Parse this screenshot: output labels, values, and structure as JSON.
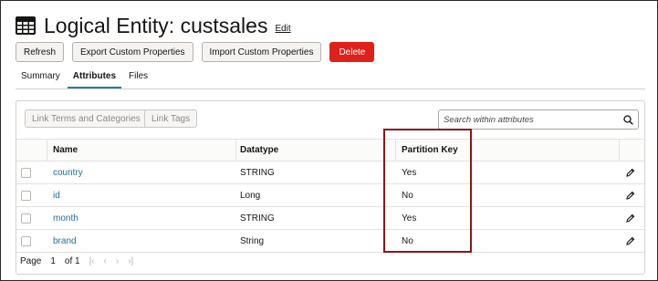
{
  "header": {
    "title": "Logical Entity: custsales",
    "edit_label": "Edit"
  },
  "toolbar": {
    "refresh": "Refresh",
    "export": "Export Custom Properties",
    "import": "Import Custom Properties",
    "delete": "Delete"
  },
  "tabs": [
    {
      "label": "Summary",
      "active": false
    },
    {
      "label": "Attributes",
      "active": true
    },
    {
      "label": "Files",
      "active": false
    }
  ],
  "actions": {
    "link_terms": "Link Terms and Categories",
    "link_tags": "Link Tags"
  },
  "search": {
    "placeholder": "Search within attributes"
  },
  "table": {
    "columns": [
      "Name",
      "Datatype",
      "Partition Key"
    ],
    "rows": [
      {
        "name": "country",
        "datatype": "STRING",
        "partition_key": "Yes"
      },
      {
        "name": "id",
        "datatype": "Long",
        "partition_key": "No"
      },
      {
        "name": "month",
        "datatype": "STRING",
        "partition_key": "Yes"
      },
      {
        "name": "brand",
        "datatype": "String",
        "partition_key": "No"
      }
    ]
  },
  "pager": {
    "page_label": "Page",
    "current": "1",
    "of_label": "of 1"
  },
  "colors": {
    "accent": "#227e9e",
    "danger": "#e0211b",
    "link": "#1f6f9a",
    "highlight": "#8a1616"
  },
  "icons": [
    "table-icon",
    "search-icon",
    "pencil-icon",
    "first-page-icon",
    "prev-page-icon",
    "next-page-icon",
    "last-page-icon"
  ]
}
